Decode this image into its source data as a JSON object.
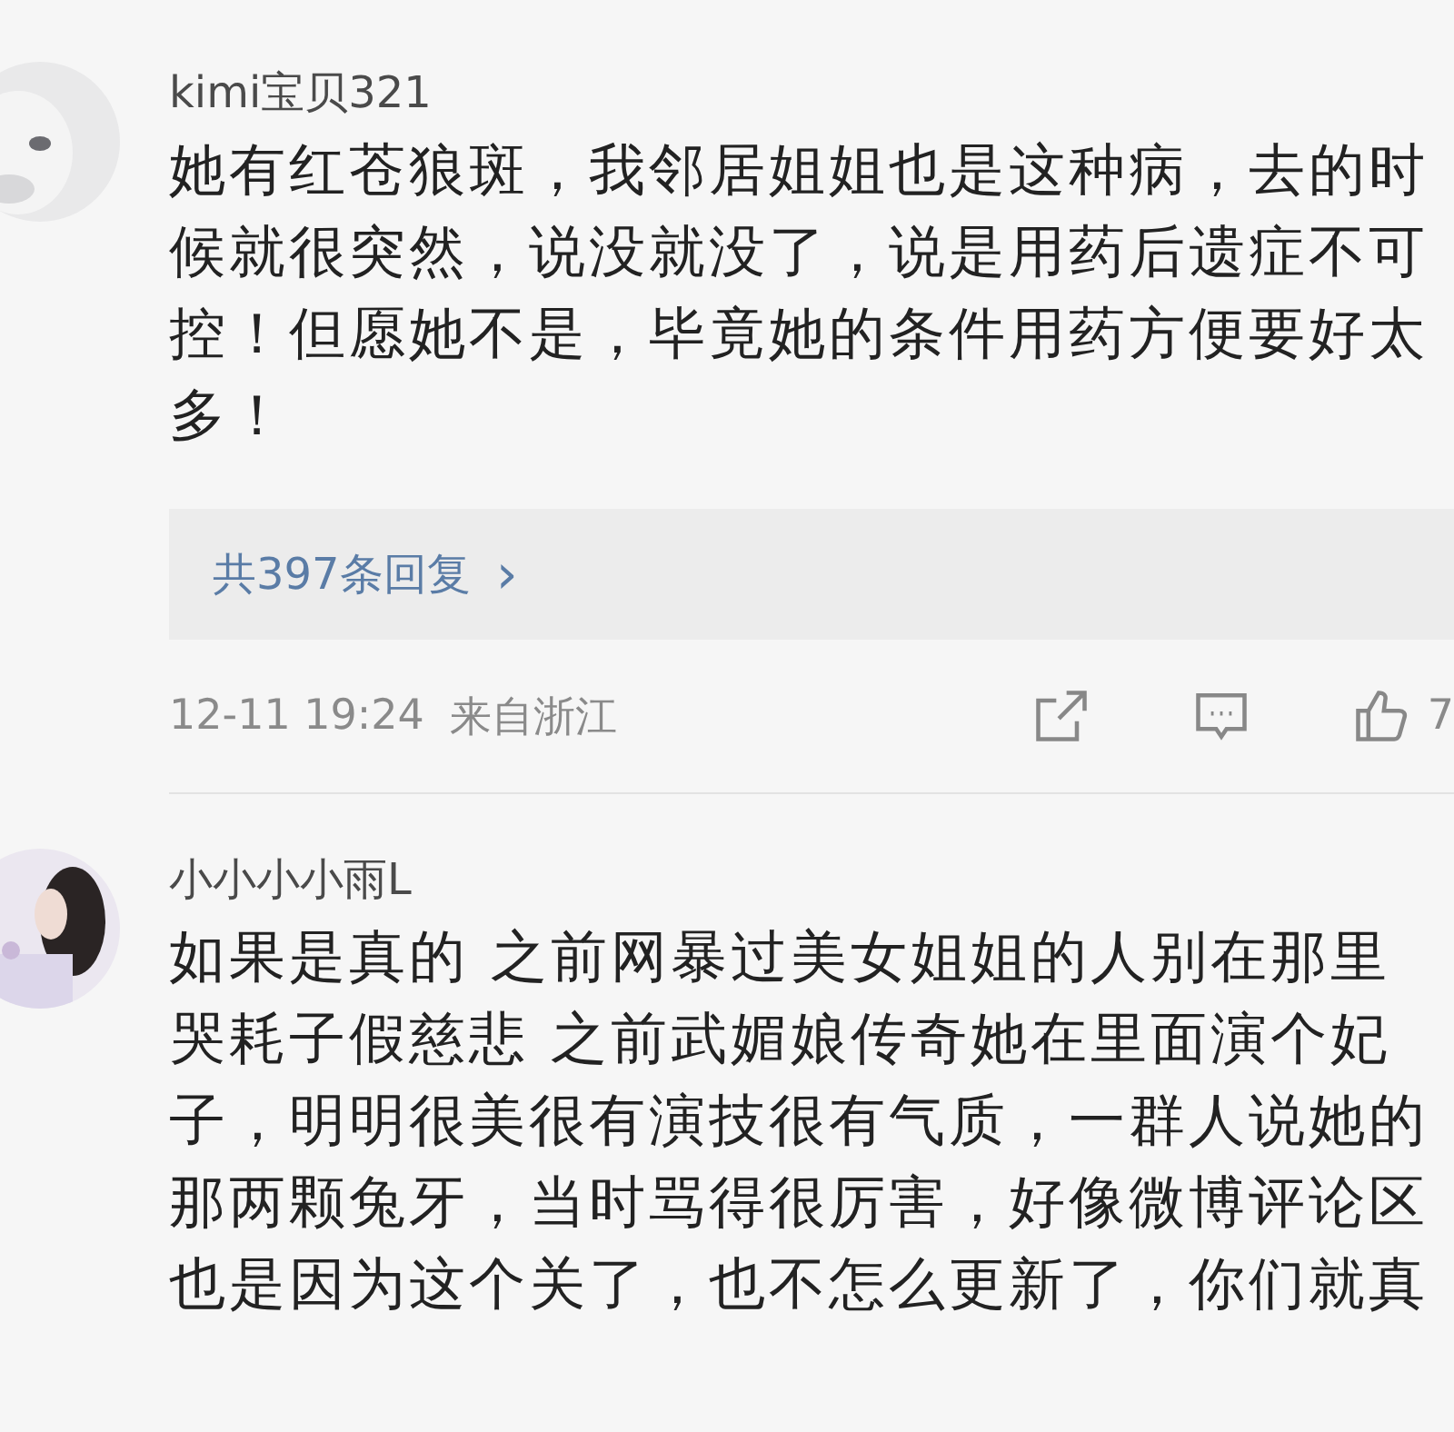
{
  "comments": [
    {
      "user": "kimi宝贝321",
      "text": "她有红苍狼斑，我邻居姐姐也是这种病，去的时候就很突然，说没就没了，说是用药后遗症不可控！但愿她不是，毕竟她的条件用药方便要好太多！",
      "replies": "共397条回复",
      "replies_arrow": "›",
      "time": "12-11 19:24",
      "location": "来自浙江",
      "likes": "7"
    },
    {
      "user": "小小小小雨L",
      "text": "如果是真的 之前网暴过美女姐姐的人别在那里哭耗子假慈悲 之前武媚娘传奇她在里面演个妃子，明明很美很有演技很有气质，一群人说她的那两颗兔牙，当时骂得很厉害，好像微博评论区也是因为这个关了，也不怎么更新了，你们就真"
    }
  ]
}
